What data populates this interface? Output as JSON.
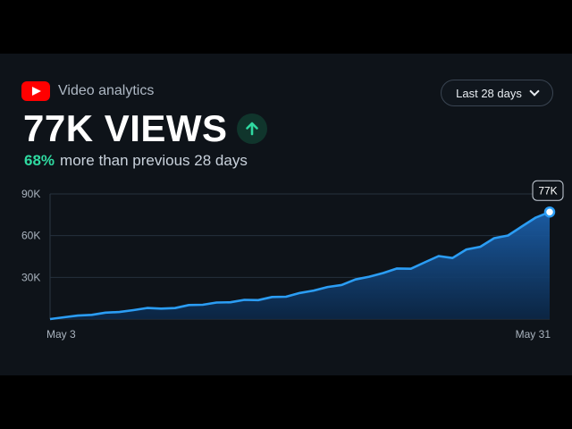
{
  "app": {
    "title": "Video analytics",
    "logo_icon": "youtube-logo-icon"
  },
  "range_select": {
    "selected": "Last 28 days"
  },
  "summary": {
    "views_headline": "77K VIEWS",
    "trend_icon": "arrow-up-icon",
    "change_percent": "68%",
    "change_text": "more than previous 28 days"
  },
  "colors": {
    "accent_line": "#2b9df4",
    "positive": "#2fd9a0",
    "brand": "#ff0000"
  },
  "chart_data": {
    "type": "area",
    "title": "",
    "xlabel": "",
    "ylabel": "",
    "ylim": [
      0,
      90000
    ],
    "y_ticks": [
      {
        "value": 90000,
        "label": "90K"
      },
      {
        "value": 60000,
        "label": "60K"
      },
      {
        "value": 30000,
        "label": "30K"
      }
    ],
    "x_tick_labels": {
      "start": "May 3",
      "end": "May 31"
    },
    "grid": true,
    "series": [
      {
        "values": [
          0,
          1300,
          2500,
          3000,
          4600,
          5100,
          6400,
          8000,
          7500,
          7900,
          10100,
          10300,
          11900,
          12100,
          13800,
          13600,
          15900,
          16100,
          18800,
          20500,
          23100,
          24500,
          28500,
          30500,
          33100,
          36400,
          36200,
          40800,
          45300,
          43900,
          50100,
          52000,
          58200,
          60100,
          66600,
          73000,
          77000
        ]
      }
    ],
    "last_point_label": "77K"
  }
}
